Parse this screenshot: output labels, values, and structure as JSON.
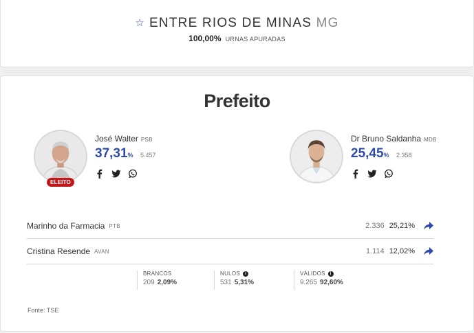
{
  "header": {
    "star_icon": "star-outline-icon",
    "city": "ENTRE RIOS DE MINAS",
    "state": "MG",
    "urnas_pct": "100,00%",
    "urnas_label": "URNAS APURADAS"
  },
  "office": {
    "title": "Prefeito"
  },
  "candidates": [
    {
      "name": "José Walter",
      "party": "PSB",
      "pct": "37,31",
      "pct_symbol": "%",
      "votes": "5.457",
      "badge": "ELEITO"
    },
    {
      "name": "Dr Bruno Saldanha",
      "party": "MDB",
      "pct": "25,45",
      "pct_symbol": "%",
      "votes": "2.358"
    }
  ],
  "other_candidates": [
    {
      "name": "Marinho da Farmacia",
      "party": "PTB",
      "votes": "2.336",
      "pct": "25,21%"
    },
    {
      "name": "Cristina Resende",
      "party": "AVAN",
      "votes": "1.114",
      "pct": "12,02%"
    }
  ],
  "summary": {
    "brancos": {
      "label": "BRANCOS",
      "votes": "209",
      "pct": "2,09%"
    },
    "nulos": {
      "label": "NULOS",
      "votes": "531",
      "pct": "5,31%"
    },
    "validos": {
      "label": "VÁLIDOS",
      "votes": "9.265",
      "pct": "92,60%"
    },
    "info_glyph": "i"
  },
  "footer": {
    "source": "Fonte: TSE"
  },
  "colors": {
    "accent": "#2d4aa8",
    "badge": "#c4171a",
    "text": "#333333"
  }
}
